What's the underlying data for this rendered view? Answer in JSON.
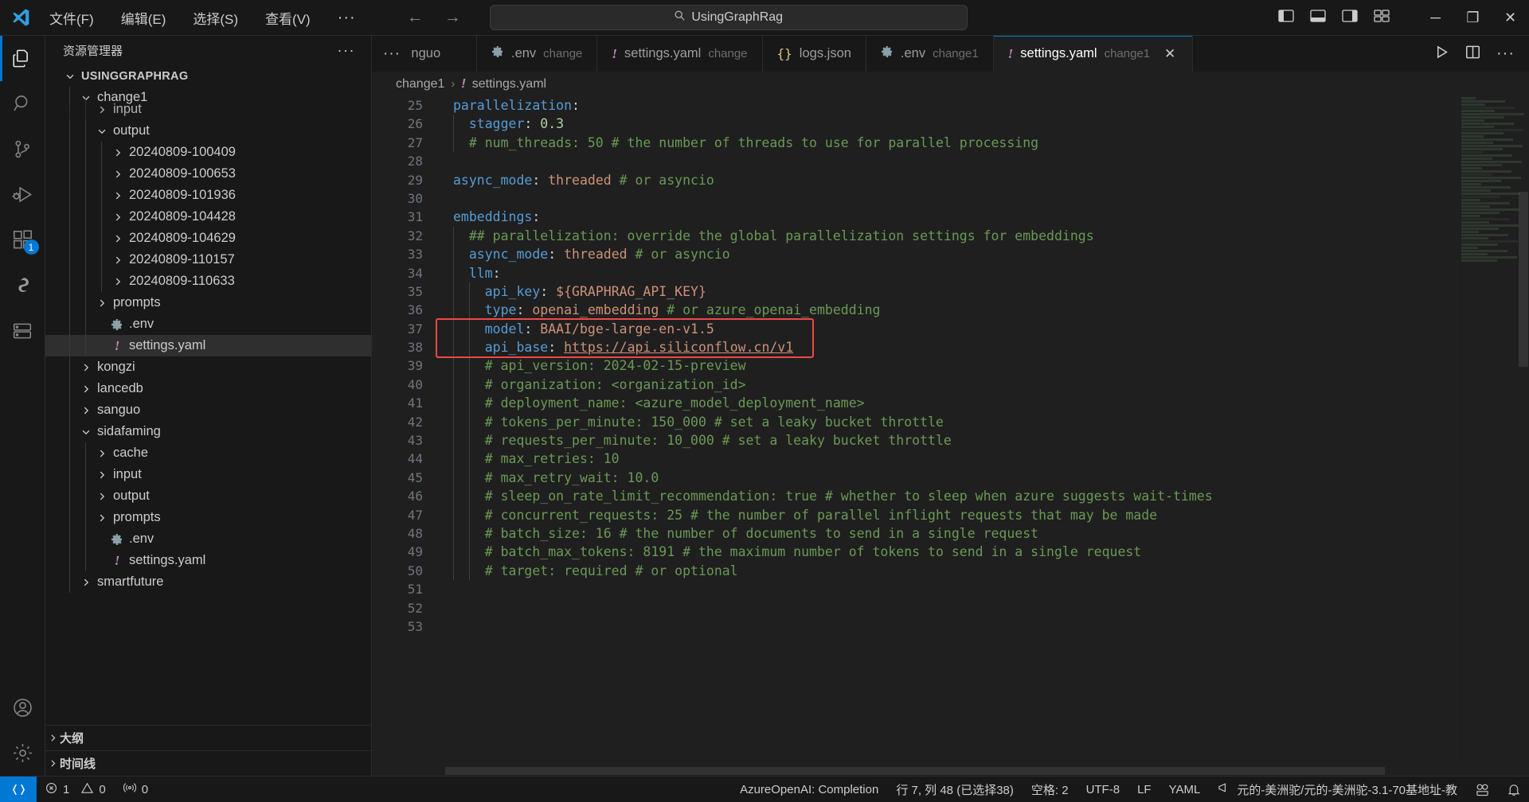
{
  "titlebar": {
    "logo": "vscode-logo",
    "menus": [
      "文件(F)",
      "编辑(E)",
      "选择(S)",
      "查看(V)"
    ],
    "more_label": "···",
    "back_label": "←",
    "forward_label": "→",
    "command_center_text": "UsingGraphRag",
    "minimize": "─",
    "maximize": "❐",
    "close": "✕"
  },
  "activitybar": {
    "items": [
      {
        "name": "explorer",
        "badge": ""
      },
      {
        "name": "search",
        "badge": ""
      },
      {
        "name": "source-control",
        "badge": ""
      },
      {
        "name": "run-and-debug",
        "badge": ""
      },
      {
        "name": "extensions",
        "badge": "1"
      },
      {
        "name": "codegeex",
        "badge": ""
      },
      {
        "name": "remote-explorer",
        "badge": ""
      },
      {
        "name": "test-beaker",
        "badge": ""
      }
    ],
    "bottom": [
      {
        "name": "accounts",
        "badge": ""
      },
      {
        "name": "manage-settings",
        "badge": ""
      }
    ]
  },
  "sidebar": {
    "title": "资源管理器",
    "more_actions": "···",
    "tree": [
      {
        "label": "USINGGRAPHRAG",
        "depth": 0,
        "type": "root",
        "state": "expanded"
      },
      {
        "label": "change1",
        "depth": 1,
        "type": "folder",
        "state": "expanded"
      },
      {
        "label": "input",
        "depth": 2,
        "type": "folder",
        "state": "collapsed",
        "clipped": true
      },
      {
        "label": "output",
        "depth": 2,
        "type": "folder",
        "state": "expanded"
      },
      {
        "label": "20240809-100409",
        "depth": 3,
        "type": "folder",
        "state": "collapsed"
      },
      {
        "label": "20240809-100653",
        "depth": 3,
        "type": "folder",
        "state": "collapsed"
      },
      {
        "label": "20240809-101936",
        "depth": 3,
        "type": "folder",
        "state": "collapsed"
      },
      {
        "label": "20240809-104428",
        "depth": 3,
        "type": "folder",
        "state": "collapsed"
      },
      {
        "label": "20240809-104629",
        "depth": 3,
        "type": "folder",
        "state": "collapsed"
      },
      {
        "label": "20240809-110157",
        "depth": 3,
        "type": "folder",
        "state": "collapsed"
      },
      {
        "label": "20240809-110633",
        "depth": 3,
        "type": "folder",
        "state": "collapsed"
      },
      {
        "label": "prompts",
        "depth": 2,
        "type": "folder",
        "state": "collapsed"
      },
      {
        "label": ".env",
        "depth": 2,
        "type": "file-env",
        "state": "none"
      },
      {
        "label": "settings.yaml",
        "depth": 2,
        "type": "file-yaml",
        "state": "none",
        "selected": true
      },
      {
        "label": "kongzi",
        "depth": 1,
        "type": "folder",
        "state": "collapsed"
      },
      {
        "label": "lancedb",
        "depth": 1,
        "type": "folder",
        "state": "collapsed"
      },
      {
        "label": "sanguo",
        "depth": 1,
        "type": "folder",
        "state": "collapsed"
      },
      {
        "label": "sidafaming",
        "depth": 1,
        "type": "folder",
        "state": "expanded"
      },
      {
        "label": "cache",
        "depth": 2,
        "type": "folder",
        "state": "collapsed"
      },
      {
        "label": "input",
        "depth": 2,
        "type": "folder",
        "state": "collapsed"
      },
      {
        "label": "output",
        "depth": 2,
        "type": "folder",
        "state": "collapsed"
      },
      {
        "label": "prompts",
        "depth": 2,
        "type": "folder",
        "state": "collapsed"
      },
      {
        "label": ".env",
        "depth": 2,
        "type": "file-env",
        "state": "none"
      },
      {
        "label": "settings.yaml",
        "depth": 2,
        "type": "file-yaml",
        "state": "none"
      },
      {
        "label": "smartfuture",
        "depth": 1,
        "type": "folder",
        "state": "collapsed"
      }
    ],
    "sections": [
      {
        "label": "大纲",
        "state": "collapsed"
      },
      {
        "label": "时间线",
        "state": "collapsed"
      }
    ]
  },
  "tabs": {
    "overflow_indicator": "···",
    "items": [
      {
        "label": "sanguo",
        "desc": "",
        "icon": "",
        "active": false,
        "partial": true
      },
      {
        "label": ".env",
        "desc": "change",
        "icon": "gear-icon",
        "active": false
      },
      {
        "label": "settings.yaml",
        "desc": "change",
        "icon": "yaml-icon",
        "active": false
      },
      {
        "label": "logs.json",
        "desc": "",
        "icon": "json-icon",
        "active": false
      },
      {
        "label": ".env",
        "desc": "change1",
        "icon": "gear-icon",
        "active": false
      },
      {
        "label": "settings.yaml",
        "desc": "change1",
        "icon": "yaml-icon",
        "active": true,
        "close": "✕"
      }
    ],
    "actions": [
      "run-icon",
      "split-editor-icon",
      "more-actions-icon"
    ]
  },
  "breadcrumbs": {
    "folder": "change1",
    "separator": "›",
    "file": "settings.yaml"
  },
  "editor": {
    "first_line_number": 25,
    "lines": [
      {
        "n": 25,
        "indent": 0,
        "tokens": [
          {
            "t": "parallelization",
            "c": "key"
          },
          {
            "t": ":",
            "c": "plain"
          }
        ]
      },
      {
        "n": 26,
        "indent": 1,
        "tokens": [
          {
            "t": "  stagger",
            "c": "key"
          },
          {
            "t": ": ",
            "c": "plain"
          },
          {
            "t": "0.3",
            "c": "num"
          }
        ]
      },
      {
        "n": 27,
        "indent": 1,
        "tokens": [
          {
            "t": "  # num_threads: 50 # the number of threads to use for parallel processing",
            "c": "com"
          }
        ]
      },
      {
        "n": 28,
        "indent": 0,
        "tokens": []
      },
      {
        "n": 29,
        "indent": 0,
        "tokens": [
          {
            "t": "async_mode",
            "c": "key"
          },
          {
            "t": ": ",
            "c": "plain"
          },
          {
            "t": "threaded ",
            "c": "str"
          },
          {
            "t": "# or asyncio",
            "c": "com"
          }
        ]
      },
      {
        "n": 30,
        "indent": 0,
        "tokens": []
      },
      {
        "n": 31,
        "indent": 0,
        "tokens": [
          {
            "t": "embeddings",
            "c": "key"
          },
          {
            "t": ":",
            "c": "plain"
          }
        ]
      },
      {
        "n": 32,
        "indent": 1,
        "tokens": [
          {
            "t": "  ## parallelization: override the global parallelization settings for embeddings",
            "c": "com"
          }
        ]
      },
      {
        "n": 33,
        "indent": 1,
        "tokens": [
          {
            "t": "  async_mode",
            "c": "key"
          },
          {
            "t": ": ",
            "c": "plain"
          },
          {
            "t": "threaded ",
            "c": "str"
          },
          {
            "t": "# or asyncio",
            "c": "com"
          }
        ]
      },
      {
        "n": 34,
        "indent": 1,
        "tokens": [
          {
            "t": "  llm",
            "c": "key"
          },
          {
            "t": ":",
            "c": "plain"
          }
        ]
      },
      {
        "n": 35,
        "indent": 2,
        "tokens": [
          {
            "t": "    api_key",
            "c": "key"
          },
          {
            "t": ": ",
            "c": "plain"
          },
          {
            "t": "${GRAPHRAG_API_KEY}",
            "c": "str"
          }
        ]
      },
      {
        "n": 36,
        "indent": 2,
        "tokens": [
          {
            "t": "    type",
            "c": "key"
          },
          {
            "t": ": ",
            "c": "plain"
          },
          {
            "t": "openai_embedding ",
            "c": "str"
          },
          {
            "t": "# or azure_openai_embedding",
            "c": "com"
          }
        ]
      },
      {
        "n": 37,
        "indent": 2,
        "tokens": [
          {
            "t": "    model",
            "c": "key"
          },
          {
            "t": ": ",
            "c": "plain"
          },
          {
            "t": "BAAI/bge-large-en-v1.5",
            "c": "str"
          }
        ],
        "highlight": true
      },
      {
        "n": 38,
        "indent": 2,
        "tokens": [
          {
            "t": "    api_base",
            "c": "key"
          },
          {
            "t": ": ",
            "c": "plain"
          },
          {
            "t": "https://api.siliconflow.cn/v1",
            "c": "link"
          }
        ],
        "highlight": true
      },
      {
        "n": 39,
        "indent": 2,
        "tokens": [
          {
            "t": "    # api_version: 2024-02-15-preview",
            "c": "com"
          }
        ]
      },
      {
        "n": 40,
        "indent": 2,
        "tokens": [
          {
            "t": "    # organization: <organization_id>",
            "c": "com"
          }
        ]
      },
      {
        "n": 41,
        "indent": 2,
        "tokens": [
          {
            "t": "    # deployment_name: <azure_model_deployment_name>",
            "c": "com"
          }
        ]
      },
      {
        "n": 42,
        "indent": 2,
        "tokens": [
          {
            "t": "    # tokens_per_minute: 150_000 # set a leaky bucket throttle",
            "c": "com"
          }
        ]
      },
      {
        "n": 43,
        "indent": 2,
        "tokens": [
          {
            "t": "    # requests_per_minute: 10_000 # set a leaky bucket throttle",
            "c": "com"
          }
        ]
      },
      {
        "n": 44,
        "indent": 2,
        "tokens": [
          {
            "t": "    # max_retries: 10",
            "c": "com"
          }
        ]
      },
      {
        "n": 45,
        "indent": 2,
        "tokens": [
          {
            "t": "    # max_retry_wait: 10.0",
            "c": "com"
          }
        ]
      },
      {
        "n": 46,
        "indent": 2,
        "tokens": [
          {
            "t": "    # sleep_on_rate_limit_recommendation: true # whether to sleep when azure suggests wait-times",
            "c": "com"
          }
        ]
      },
      {
        "n": 47,
        "indent": 2,
        "tokens": [
          {
            "t": "    # concurrent_requests: 25 # the number of parallel inflight requests that may be made",
            "c": "com"
          }
        ]
      },
      {
        "n": 48,
        "indent": 2,
        "tokens": [
          {
            "t": "    # batch_size: 16 # the number of documents to send in a single request",
            "c": "com"
          }
        ]
      },
      {
        "n": 49,
        "indent": 2,
        "tokens": [
          {
            "t": "    # batch_max_tokens: 8191 # the maximum number of tokens to send in a single request",
            "c": "com"
          }
        ]
      },
      {
        "n": 50,
        "indent": 2,
        "tokens": [
          {
            "t": "    # target: required # or optional",
            "c": "com"
          }
        ]
      },
      {
        "n": 51,
        "indent": 0,
        "tokens": []
      },
      {
        "n": 52,
        "indent": 0,
        "tokens": []
      },
      {
        "n": 53,
        "indent": 0,
        "tokens": []
      }
    ]
  },
  "statusbar": {
    "remote_icon": "remote-indicator",
    "errors": "1",
    "warnings": "0",
    "ports": "0",
    "azure": "AzureOpenAI: Completion",
    "cursor": "行 7, 列 48 (已选择38)",
    "indent": "空格: 2",
    "encoding": "UTF-8",
    "eol": "LF",
    "language": "YAML",
    "model": "元的-美洲驼/元的-美洲驼-3.1-70基地址-教",
    "bell": "bell-icon",
    "smiley": "feedback-icon"
  },
  "colors": {
    "accent": "#0078d4",
    "highlight_box": "#f04747",
    "bg": "#1f1f1f",
    "panel_bg": "#181818"
  }
}
